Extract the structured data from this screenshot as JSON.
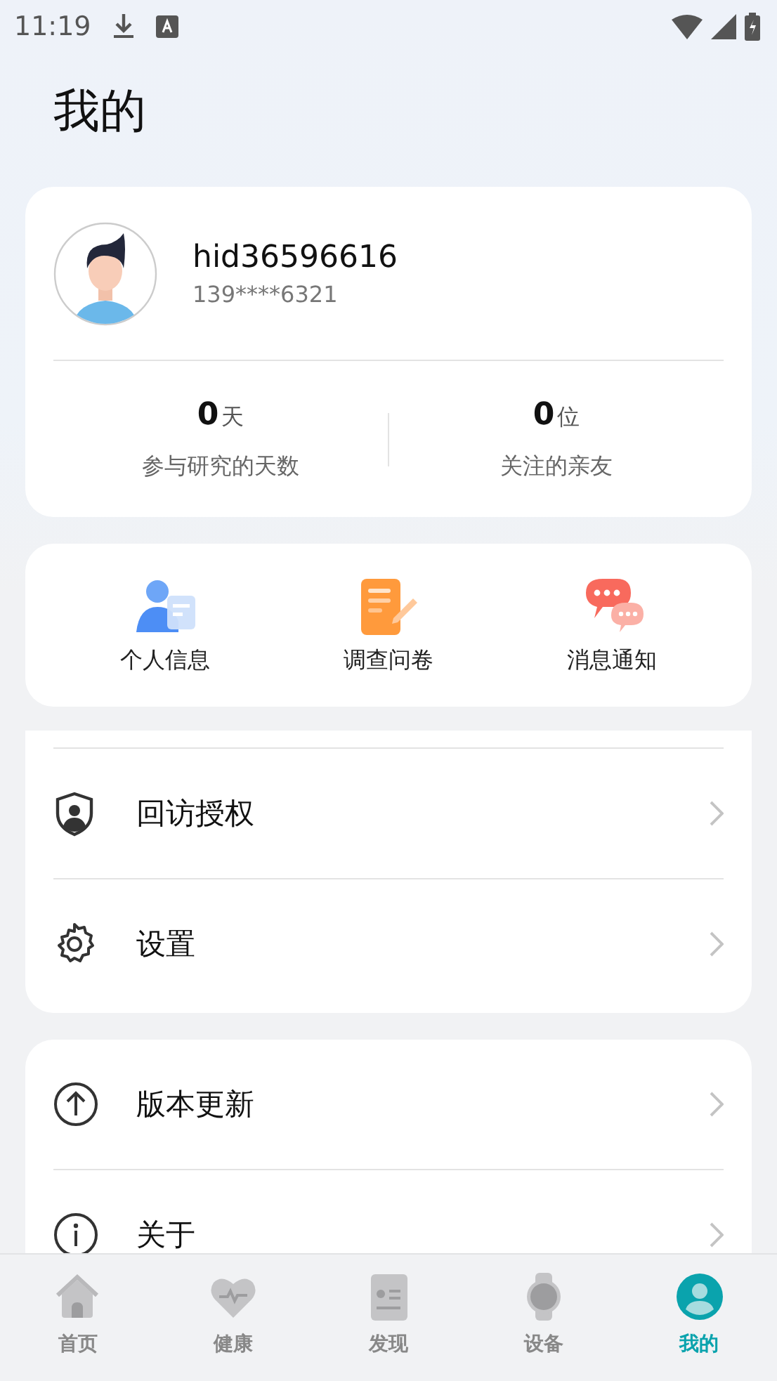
{
  "status_bar": {
    "time": "11:19"
  },
  "title": "我的",
  "profile": {
    "name": "hid36596616",
    "phone": "139****6321"
  },
  "stats": [
    {
      "value": "0",
      "unit": "天",
      "label": "参与研究的天数"
    },
    {
      "value": "0",
      "unit": "位",
      "label": "关注的亲友"
    }
  ],
  "shortcuts": [
    {
      "label": "个人信息"
    },
    {
      "label": "调查问卷"
    },
    {
      "label": "消息通知"
    }
  ],
  "menu_sections": [
    {
      "items": [
        {
          "label": "回访授权"
        },
        {
          "label": "设置"
        }
      ]
    },
    {
      "items": [
        {
          "label": "版本更新"
        },
        {
          "label": "关于"
        }
      ]
    }
  ],
  "nav": [
    {
      "label": "首页",
      "selected": false
    },
    {
      "label": "健康",
      "selected": false
    },
    {
      "label": "发现",
      "selected": false
    },
    {
      "label": "设备",
      "selected": false
    },
    {
      "label": "我的",
      "selected": true
    }
  ]
}
